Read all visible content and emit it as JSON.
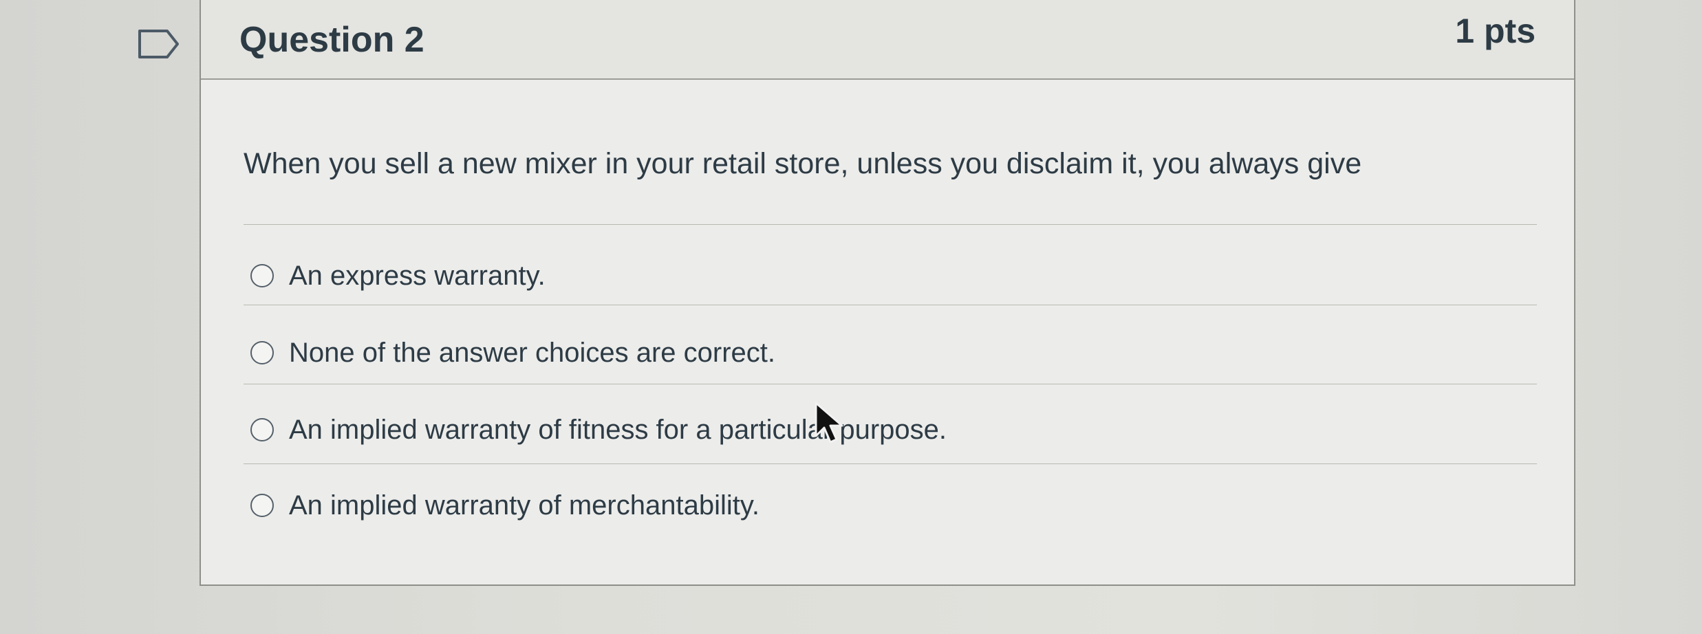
{
  "question": {
    "title": "Question 2",
    "points": "1 pts",
    "prompt": "When you sell a new mixer in your retail store, unless you disclaim it, you always give",
    "answers": [
      {
        "label": "An express warranty."
      },
      {
        "label": "None of the answer choices are correct."
      },
      {
        "label": "An implied warranty of fitness for a particular purpose."
      },
      {
        "label": "An implied warranty of merchantability."
      }
    ]
  },
  "colors": {
    "text": "#2d3b45",
    "border": "#8e8e8a",
    "header_background": "#e4e4e0",
    "card_background": "#ececea"
  },
  "icons": {
    "flag": "flag-outline-icon",
    "cursor": "mouse-pointer-icon"
  }
}
